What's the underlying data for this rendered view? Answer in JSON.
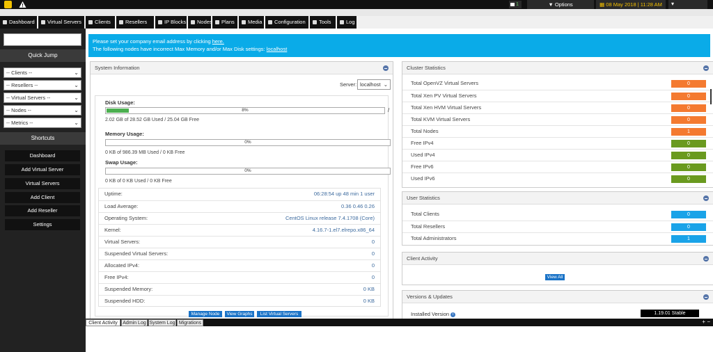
{
  "topbar": {
    "mail_count": "1",
    "options_label": "Options",
    "datetime": "08 May 2018 | 11:28 AM",
    "caret": "▾"
  },
  "nav": [
    {
      "label": "Dashboard",
      "icon": "home-icon"
    },
    {
      "label": "Virtual Servers",
      "icon": "list-icon"
    },
    {
      "label": "Clients",
      "icon": "users-icon"
    },
    {
      "label": "Resellers",
      "icon": "user-icon"
    },
    {
      "label": "IP Blocks",
      "icon": "grid-icon"
    },
    {
      "label": "Nodes",
      "icon": "server-icon"
    },
    {
      "label": "Plans",
      "icon": "plans-icon"
    },
    {
      "label": "Media",
      "icon": "media-icon"
    },
    {
      "label": "Configuration",
      "icon": "gear-icon"
    },
    {
      "label": "Tools",
      "icon": "wrench-icon"
    },
    {
      "label": "Log",
      "icon": "log-icon"
    }
  ],
  "sidebar": {
    "quick_jump": "Quick Jump",
    "selects": [
      "-- Clients --",
      "-- Resellers --",
      "-- Virtual Servers --",
      "-- Nodes --",
      "-- Metrics --"
    ],
    "shortcuts": "Shortcuts",
    "buttons": [
      "Dashboard",
      "Add Virtual Server",
      "Virtual Servers",
      "Add Client",
      "Add Reseller",
      "Settings"
    ]
  },
  "alert": {
    "line1_prefix": "Please set your company email address by clicking",
    "line1_link": "here.",
    "line2_prefix": "The following nodes have incorrect Max Memory and/or Max Disk settings:",
    "line2_link": "localhost"
  },
  "system_info": {
    "title": "System Information",
    "server_label": "Server:",
    "server_value": "localhost",
    "disk_label": "Disk Usage:",
    "disk_percent": 8,
    "disk_percent_label": "8%",
    "disk_slash": "/",
    "disk_detail": "2.02 GB of 28.52 GB Used / 25.04 GB Free",
    "memory_label": "Memory Usage:",
    "memory_percent": 0,
    "memory_percent_label": "0%",
    "memory_detail": "0 KB of 986.39 MB Used / 0 KB Free",
    "swap_label": "Swap Usage:",
    "swap_percent": 0,
    "swap_percent_label": "0%",
    "swap_detail": "0 KB of 0 KB Used / 0 KB Free",
    "rows": [
      {
        "k": "Uptime:",
        "v": "06:28:54 up 48 min 1 user"
      },
      {
        "k": "Load Average:",
        "v": "0.36 0.46 0.26"
      },
      {
        "k": "Operating System:",
        "v": "CentOS Linux release 7.4.1708 (Core)"
      },
      {
        "k": "Kernel:",
        "v": "4.16.7-1.el7.elrepo.x86_64"
      },
      {
        "k": "Virtual Servers:",
        "v": "0"
      },
      {
        "k": "Suspended Virtual Servers:",
        "v": "0"
      },
      {
        "k": "Allocated IPv4:",
        "v": "0"
      },
      {
        "k": "Free IPv4:",
        "v": "0"
      },
      {
        "k": "Suspended Memory:",
        "v": "0 KB"
      },
      {
        "k": "Suspended HDD:",
        "v": "0 KB"
      }
    ],
    "actions": [
      "Manage Node",
      "View Graphs",
      "List Virtual Servers"
    ]
  },
  "cluster_stats": {
    "title": "Cluster Statistics",
    "rows": [
      {
        "k": "Total OpenVZ Virtual Servers",
        "v": "0",
        "color": "#f47a30"
      },
      {
        "k": "Total Xen PV Virtual Servers",
        "v": "0",
        "color": "#f47a30"
      },
      {
        "k": "Total Xen HVM Virtual Servers",
        "v": "0",
        "color": "#f47a30"
      },
      {
        "k": "Total KVM Virtual Servers",
        "v": "0",
        "color": "#f47a30"
      },
      {
        "k": "Total Nodes",
        "v": "1",
        "color": "#f47a30"
      },
      {
        "k": "Free IPv4",
        "v": "0",
        "color": "#6a9a1f"
      },
      {
        "k": "Used IPv4",
        "v": "0",
        "color": "#6a9a1f"
      },
      {
        "k": "Free IPv6",
        "v": "0",
        "color": "#6a9a1f"
      },
      {
        "k": "Used IPv6",
        "v": "0",
        "color": "#6a9a1f"
      }
    ]
  },
  "user_stats": {
    "title": "User Statistics",
    "rows": [
      {
        "k": "Total Clients",
        "v": "0",
        "color": "#1aa3e8"
      },
      {
        "k": "Total Resellers",
        "v": "0",
        "color": "#1aa3e8"
      },
      {
        "k": "Total Administrators",
        "v": "1",
        "color": "#1aa3e8"
      }
    ]
  },
  "client_activity": {
    "title": "Client Activity",
    "view_all": "View All"
  },
  "versions": {
    "title": "Versions & Updates",
    "installed_label": "Installed Version",
    "installed_value": "1.19.01 Stable"
  },
  "bottom_tabs": [
    "Client Activity",
    "Admin Log",
    "System Log",
    "Migrations"
  ],
  "bottom_ctrl": "+ −"
}
